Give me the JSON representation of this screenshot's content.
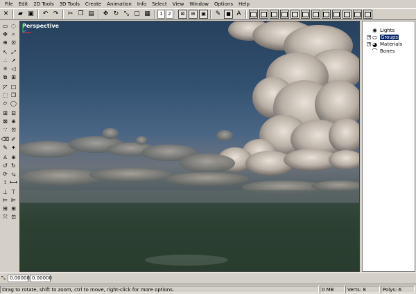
{
  "menubar": [
    "File",
    "Edit",
    "2D Tools",
    "3D Tools",
    "Create",
    "Animation",
    "Info",
    "Select",
    "View",
    "Window",
    "Options",
    "Help"
  ],
  "toolbar": {
    "view_numbers": [
      "1",
      "2"
    ]
  },
  "viewport": {
    "label": "Perspective"
  },
  "scene_tree": {
    "items": [
      {
        "label": "Lights",
        "expander": "",
        "icon": "light-icon"
      },
      {
        "label": "Groups",
        "expander": "+",
        "icon": "group-icon",
        "selected": true
      },
      {
        "label": "Materials",
        "expander": "+",
        "icon": "materials-icon"
      },
      {
        "label": "Bones",
        "expander": "",
        "icon": "bone-icon"
      }
    ]
  },
  "coords": {
    "x": "0.00000",
    "y": "0.00000"
  },
  "status": {
    "hint": "Drag to rotate, shift to zoom, ctrl to move, right-click for more options.",
    "memory": "0 MB",
    "verts": "Verts: 8",
    "polys": "Polys: 6"
  }
}
